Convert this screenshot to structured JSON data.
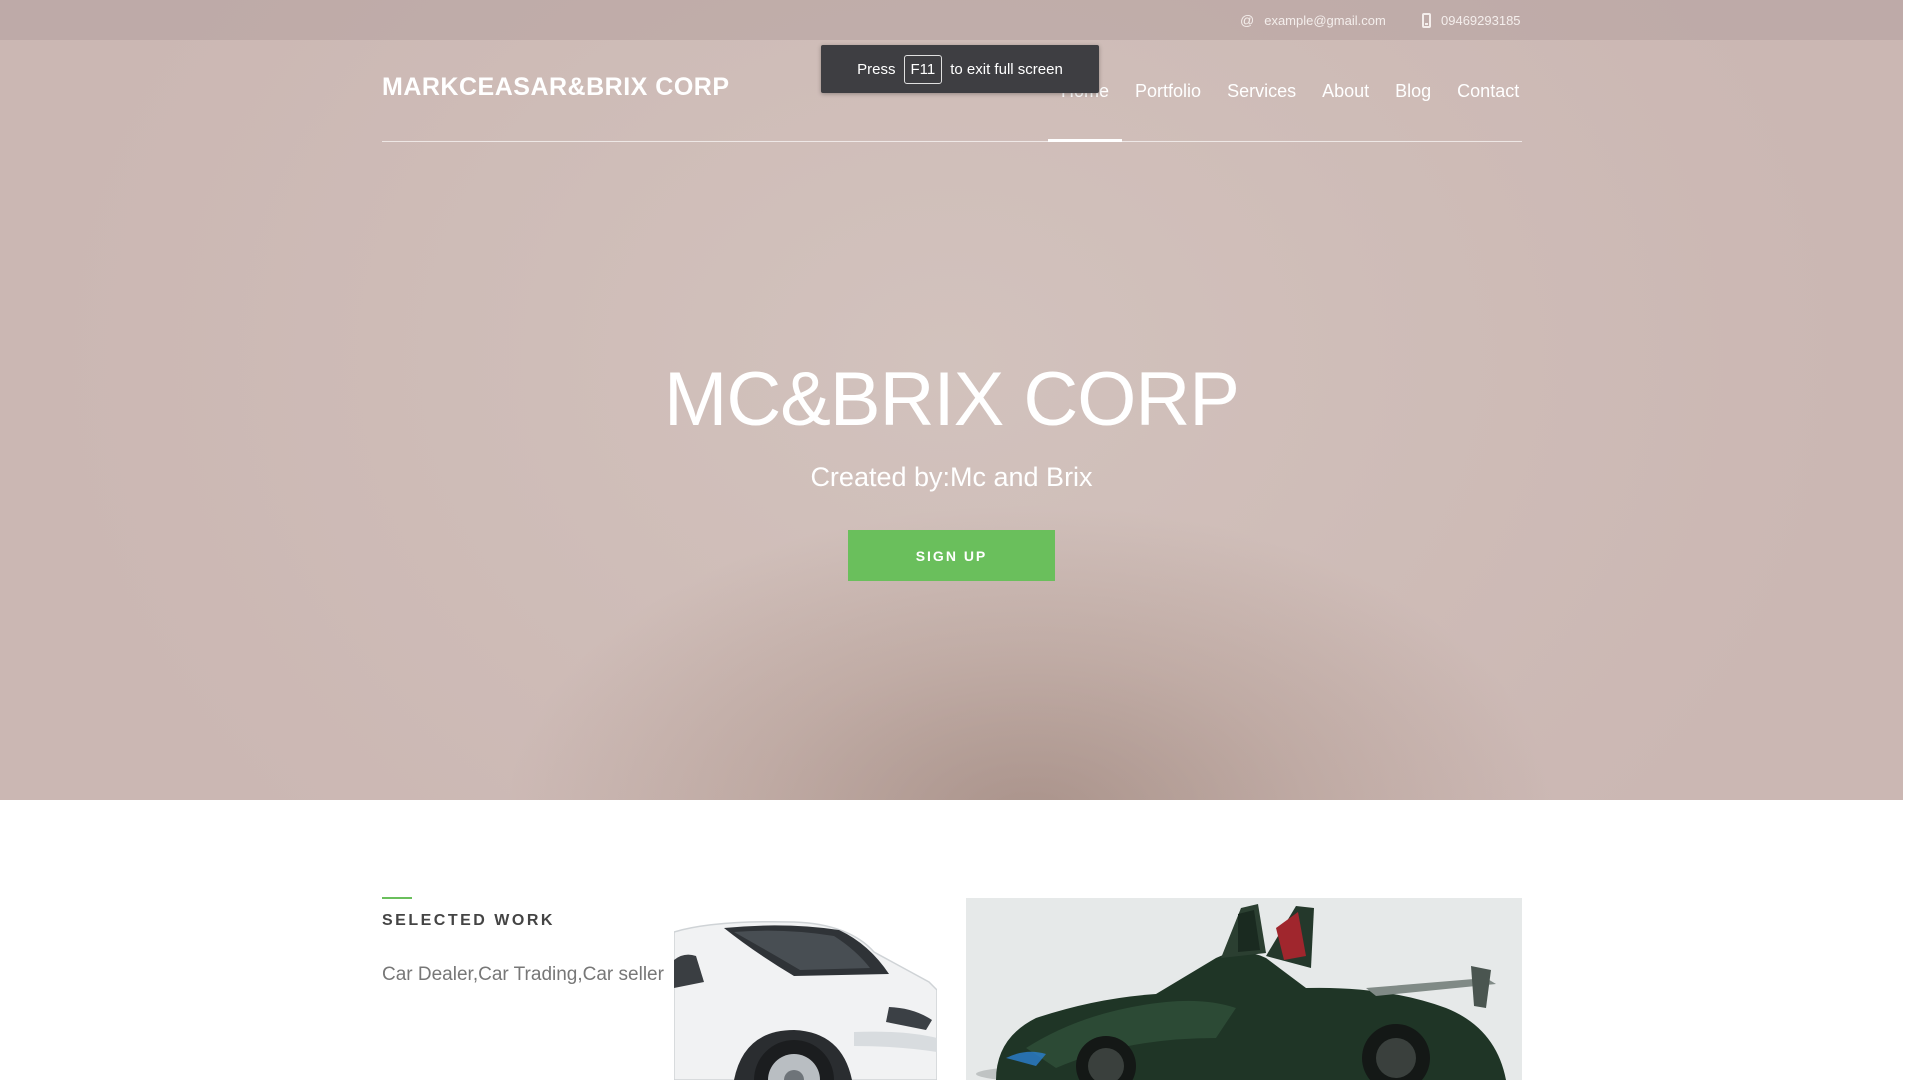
{
  "topbar": {
    "email": "example@gmail.com",
    "email_icon": "at-icon",
    "phone": "09469293185",
    "phone_icon": "mobile-phone-icon"
  },
  "header": {
    "brand": "MARKCEASAR&BRIX CORP",
    "nav": [
      {
        "label": "Home",
        "active": true
      },
      {
        "label": "Portfolio",
        "active": false
      },
      {
        "label": "Services",
        "active": false
      },
      {
        "label": "About",
        "active": false
      },
      {
        "label": "Blog",
        "active": false
      },
      {
        "label": "Contact",
        "active": false
      }
    ]
  },
  "fullscreen_toast": {
    "prefix": "Press",
    "key": "F11",
    "suffix": "to exit full screen"
  },
  "hero": {
    "title": "MC&BRIX CORP",
    "subtitle": "Created by:Mc and Brix",
    "cta": "SIGN UP"
  },
  "selected_work": {
    "title": "SELECTED WORK",
    "description": "Car Dealer,Car Trading,Car seller",
    "images": [
      "white-sedan-image",
      "green-supercar-image"
    ]
  },
  "colors": {
    "accent_green": "#6abf5c",
    "hero_bg": "#cfbdb8",
    "toast_bg": "#3e3e42"
  }
}
